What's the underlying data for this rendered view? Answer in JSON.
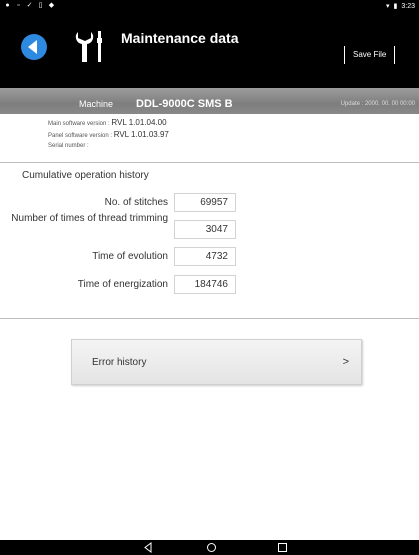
{
  "status_bar": {
    "left_icons": [
      "notification-icon",
      "notification-icon",
      "check-icon",
      "notification-icon",
      "image-icon"
    ],
    "time": "3:23"
  },
  "header": {
    "title": "Maintenance data",
    "save_button": "Save File",
    "accent_color": "#2d8ae0"
  },
  "machine": {
    "label": "Machine",
    "name": "DDL-9000C SMS B",
    "update": "Update : 2000. 00. 00  00:00"
  },
  "info": {
    "main_software_label": "Main software version :",
    "main_software_value": "RVL 1.01.04.00",
    "panel_software_label": "Panel software version :",
    "panel_software_value": "RVL 1.01.03.97",
    "serial_label": "Serial number :"
  },
  "history": {
    "title": "Cumulative operation history",
    "rows": [
      {
        "label": "No. of stitches",
        "value": "69957"
      },
      {
        "label": "Number of times of thread trimming",
        "value": "3047"
      },
      {
        "label": "Time of evolution",
        "value": "4732"
      },
      {
        "label": "Time of energization",
        "value": "184746"
      }
    ]
  },
  "error_history": {
    "label": "Error history",
    "chevron": ">"
  }
}
